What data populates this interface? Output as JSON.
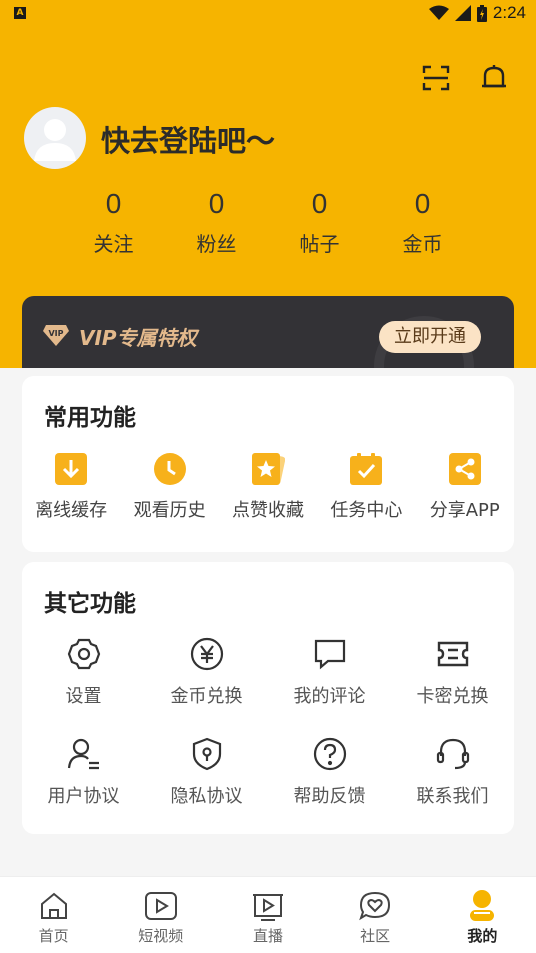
{
  "status_bar": {
    "time": "2:24",
    "app_badge": "A"
  },
  "profile": {
    "login_prompt": "快去登陆吧～"
  },
  "stats": [
    {
      "value": "0",
      "label": "关注"
    },
    {
      "value": "0",
      "label": "粉丝"
    },
    {
      "value": "0",
      "label": "帖子"
    },
    {
      "value": "0",
      "label": "金币"
    }
  ],
  "vip": {
    "title": "VIP专属特权",
    "badge": "VIP",
    "button": "立即开通"
  },
  "common": {
    "title": "常用功能",
    "items": [
      {
        "label": "离线缓存",
        "icon": "download-icon"
      },
      {
        "label": "观看历史",
        "icon": "clock-icon"
      },
      {
        "label": "点赞收藏",
        "icon": "star-icon"
      },
      {
        "label": "任务中心",
        "icon": "clipboard-check-icon"
      },
      {
        "label": "分享APP",
        "icon": "share-icon"
      }
    ]
  },
  "other": {
    "title": "其它功能",
    "items": [
      {
        "label": "设置",
        "icon": "gear-icon"
      },
      {
        "label": "金币兑换",
        "icon": "yen-coin-icon"
      },
      {
        "label": "我的评论",
        "icon": "comment-icon"
      },
      {
        "label": "卡密兑换",
        "icon": "ticket-icon"
      },
      {
        "label": "用户协议",
        "icon": "user-agreement-icon"
      },
      {
        "label": "隐私协议",
        "icon": "shield-lock-icon"
      },
      {
        "label": "帮助反馈",
        "icon": "help-icon"
      },
      {
        "label": "联系我们",
        "icon": "headset-icon"
      }
    ]
  },
  "tabs": [
    {
      "label": "首页",
      "icon": "home-icon"
    },
    {
      "label": "短视频",
      "icon": "short-video-icon"
    },
    {
      "label": "直播",
      "icon": "live-tv-icon"
    },
    {
      "label": "社区",
      "icon": "community-icon"
    },
    {
      "label": "我的",
      "icon": "profile-icon",
      "active": true
    }
  ],
  "colors": {
    "accent": "#f6b400",
    "icon_orange": "#f7b11b",
    "vip_bg": "#333236",
    "vip_gold": "#e3b98c"
  }
}
